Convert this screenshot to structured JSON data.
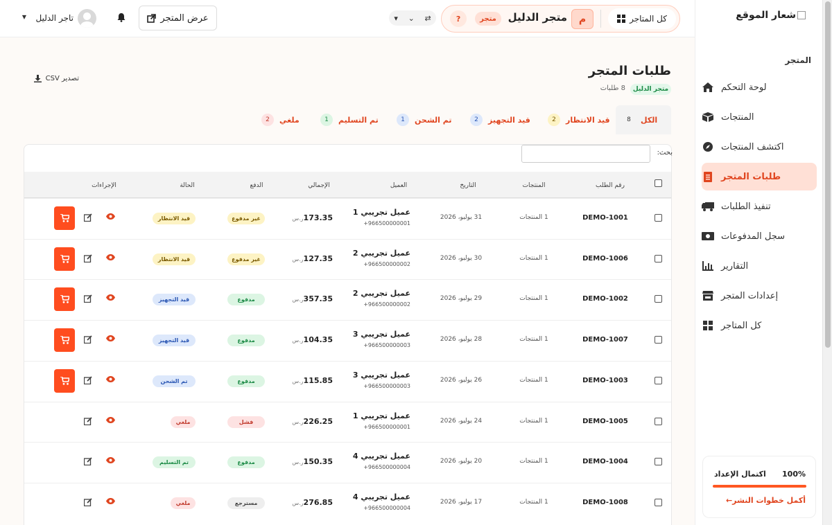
{
  "site": {
    "logo_text": "شعار الموقع"
  },
  "header": {
    "all_stores": "كل المتاجر",
    "store_initial": "م",
    "store_name": "متجر الدليل",
    "store_badge": "متجر",
    "help": "?",
    "view_store": "عرض المتجر",
    "user_name": "تاجر الدليل"
  },
  "sidebar": {
    "section": "المتجر",
    "items": [
      {
        "label": "لوحة التحكم",
        "icon": "home-icon"
      },
      {
        "label": "المنتجات",
        "icon": "box-icon"
      },
      {
        "label": "اكتشف المنتجات",
        "icon": "compass-icon"
      },
      {
        "label": "طلبات المتجر",
        "icon": "receipt-icon",
        "active": true
      },
      {
        "label": "تنفيذ الطلبات",
        "icon": "truck-icon"
      },
      {
        "label": "سجل المدفوعات",
        "icon": "money-icon"
      },
      {
        "label": "التقارير",
        "icon": "chart-icon"
      },
      {
        "label": "إعدادات المتجر",
        "icon": "store-icon"
      },
      {
        "label": "كل المتاجر",
        "icon": "grid-icon"
      }
    ],
    "setup": {
      "title": "اكتمال الإعداد",
      "percent": "100%",
      "progress": 1.0,
      "link": "أكمل خطوات النشر←"
    }
  },
  "page": {
    "title": "طلبات المتجر",
    "store_tag": "متجر الدليل",
    "order_count": "8 طلبات",
    "export": "تصدير CSV"
  },
  "filters": [
    {
      "label": "الكل",
      "count": "8",
      "active": true
    },
    {
      "label": "قيد الانتظار",
      "count": "2"
    },
    {
      "label": "قيد التجهيز",
      "count": "2"
    },
    {
      "label": "تم الشحن",
      "count": "1"
    },
    {
      "label": "تم التسليم",
      "count": "1"
    },
    {
      "label": "ملغي",
      "count": "2"
    }
  ],
  "search": {
    "label": "بحث:",
    "value": ""
  },
  "table": {
    "columns": [
      "رقم الطلب",
      "المنتجات",
      "التاريخ",
      "العميل",
      "الإجمالي",
      "الدفع",
      "الحالة",
      "الإجراءات"
    ],
    "currency": "ر.س",
    "rows": [
      {
        "id": "DEMO-1001",
        "products": "1 المنتجات",
        "date": "31 يوليو، 2026",
        "customer": "عميل تجريبي 1",
        "phone": "966500000001+",
        "total": "173.35",
        "payment": "غير مدفوع",
        "status": "قيد الانتظار",
        "cart": true
      },
      {
        "id": "DEMO-1006",
        "products": "1 المنتجات",
        "date": "30 يوليو، 2026",
        "customer": "عميل تجريبي 2",
        "phone": "966500000002+",
        "total": "127.35",
        "payment": "غير مدفوع",
        "status": "قيد الانتظار",
        "cart": true
      },
      {
        "id": "DEMO-1002",
        "products": "1 المنتجات",
        "date": "29 يوليو، 2026",
        "customer": "عميل تجريبي 2",
        "phone": "966500000002+",
        "total": "357.35",
        "payment": "مدفوع",
        "status": "قيد التجهيز",
        "cart": true
      },
      {
        "id": "DEMO-1007",
        "products": "1 المنتجات",
        "date": "28 يوليو، 2026",
        "customer": "عميل تجريبي 3",
        "phone": "966500000003+",
        "total": "104.35",
        "payment": "مدفوع",
        "status": "قيد التجهيز",
        "cart": true
      },
      {
        "id": "DEMO-1003",
        "products": "1 المنتجات",
        "date": "26 يوليو، 2026",
        "customer": "عميل تجريبي 3",
        "phone": "966500000003+",
        "total": "115.85",
        "payment": "مدفوع",
        "status": "تم الشحن",
        "cart": true
      },
      {
        "id": "DEMO-1005",
        "products": "1 المنتجات",
        "date": "24 يوليو، 2026",
        "customer": "عميل تجريبي 1",
        "phone": "966500000001+",
        "total": "226.25",
        "payment": "فشل",
        "status": "ملغي",
        "cart": false
      },
      {
        "id": "DEMO-1004",
        "products": "1 المنتجات",
        "date": "20 يوليو، 2026",
        "customer": "عميل تجريبي 4",
        "phone": "966500000004+",
        "total": "150.35",
        "payment": "مدفوع",
        "status": "تم التسليم",
        "cart": false
      },
      {
        "id": "DEMO-1008",
        "products": "1 المنتجات",
        "date": "17 يوليو، 2026",
        "customer": "عميل تجريبي 4",
        "phone": "966500000004+",
        "total": "276.85",
        "payment": "مسترجع",
        "status": "ملغي",
        "cart": false
      }
    ]
  },
  "colors": {
    "accent": "#ff4d1f",
    "accent_dark": "#e0451f"
  }
}
